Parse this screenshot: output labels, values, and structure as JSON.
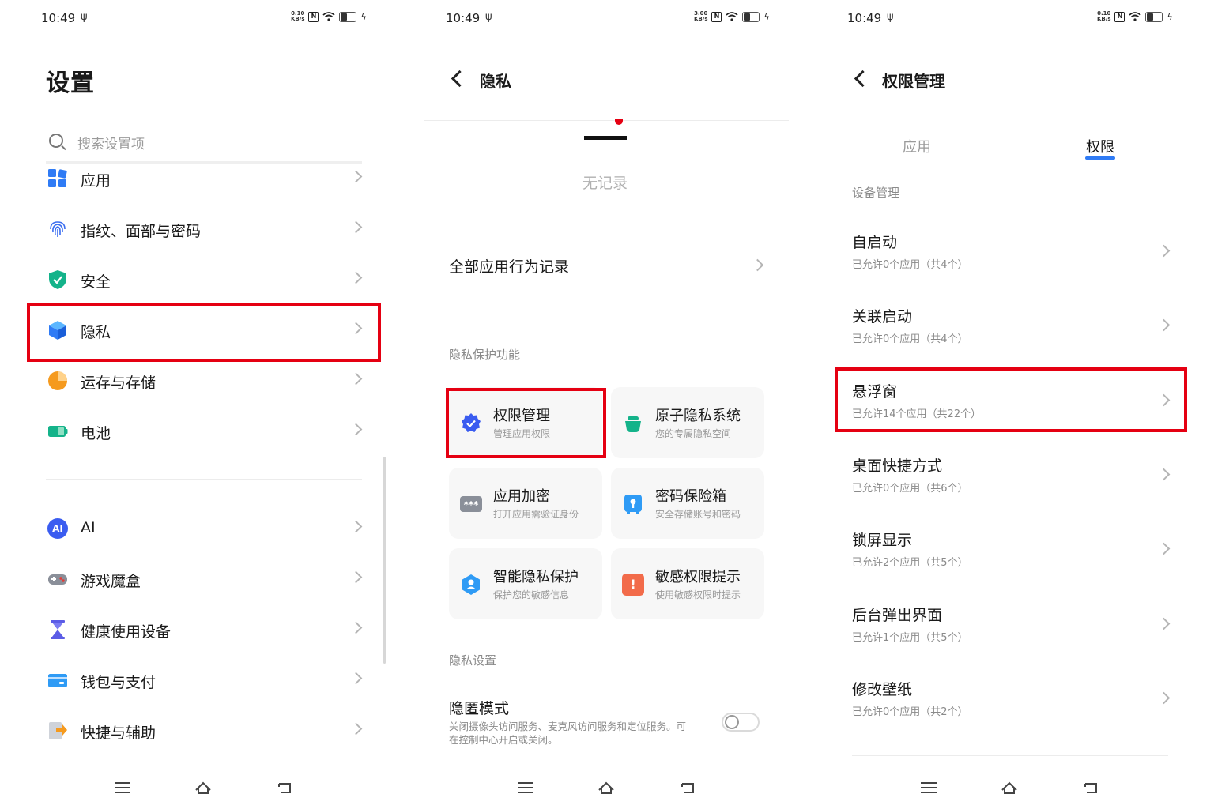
{
  "status": {
    "time": "10:49",
    "usb_glyph": "ψ",
    "nfc_glyph": "N",
    "charging_glyph": "ϟ",
    "speed_unit": "KB/s",
    "speeds": [
      "0.10",
      "3.00",
      "0.10"
    ]
  },
  "settings_panel": {
    "title": "设置",
    "search_placeholder": "搜索设置项",
    "items": [
      {
        "label": "应用",
        "icon": "apps-grid-icon"
      },
      {
        "label": "指纹、面部与密码",
        "icon": "fingerprint-icon"
      },
      {
        "label": "安全",
        "icon": "shield-check-icon"
      },
      {
        "label": "隐私",
        "icon": "privacy-cube-icon"
      },
      {
        "label": "运存与存储",
        "icon": "storage-pie-icon"
      },
      {
        "label": "电池",
        "icon": "battery-icon"
      },
      {
        "label": "AI",
        "icon": "ai-icon"
      },
      {
        "label": "游戏魔盒",
        "icon": "gamepad-icon"
      },
      {
        "label": "健康使用设备",
        "icon": "hourglass-icon"
      },
      {
        "label": "钱包与支付",
        "icon": "wallet-icon"
      },
      {
        "label": "快捷与辅助",
        "icon": "shortcut-icon"
      }
    ],
    "ai_glyph": "AI",
    "colors": {
      "highlight": "#e50012",
      "blue": "#2f7bf5",
      "green": "#14b38a",
      "orange": "#f59a1e"
    }
  },
  "privacy_panel": {
    "title": "隐私",
    "no_record": "无记录",
    "all_app_records": "全部应用行为记录",
    "protection_section": "隐私保护功能",
    "cards": [
      {
        "title": "权限管理",
        "subtitle": "管理应用权限"
      },
      {
        "title": "原子隐私系统",
        "subtitle": "您的专属隐私空间"
      },
      {
        "title": "应用加密",
        "subtitle": "打开应用需验证身份",
        "glyph": "***"
      },
      {
        "title": "密码保险箱",
        "subtitle": "安全存储账号和密码"
      },
      {
        "title": "智能隐私保护",
        "subtitle": "保护您的敏感信息"
      },
      {
        "title": "敏感权限提示",
        "subtitle": "使用敏感权限时提示",
        "glyph": "!"
      }
    ],
    "settings_section": "隐私设置",
    "hidden_mode": {
      "title": "隐匿模式",
      "desc": "关闭摄像头访问服务、麦克风访问服务和定位服务。可在控制中心开启或关闭。",
      "enabled": false
    }
  },
  "permission_panel": {
    "title": "权限管理",
    "tabs": [
      {
        "label": "应用",
        "active": false
      },
      {
        "label": "权限",
        "active": true
      }
    ],
    "section": "设备管理",
    "items": [
      {
        "title": "自启动",
        "subtitle": "已允许0个应用（共4个）"
      },
      {
        "title": "关联启动",
        "subtitle": "已允许0个应用（共4个）"
      },
      {
        "title": "悬浮窗",
        "subtitle": "已允许14个应用（共22个）"
      },
      {
        "title": "桌面快捷方式",
        "subtitle": "已允许0个应用（共6个）"
      },
      {
        "title": "锁屏显示",
        "subtitle": "已允许2个应用（共5个）"
      },
      {
        "title": "后台弹出界面",
        "subtitle": "已允许1个应用（共5个）"
      },
      {
        "title": "修改壁纸",
        "subtitle": "已允许0个应用（共2个）"
      }
    ]
  }
}
